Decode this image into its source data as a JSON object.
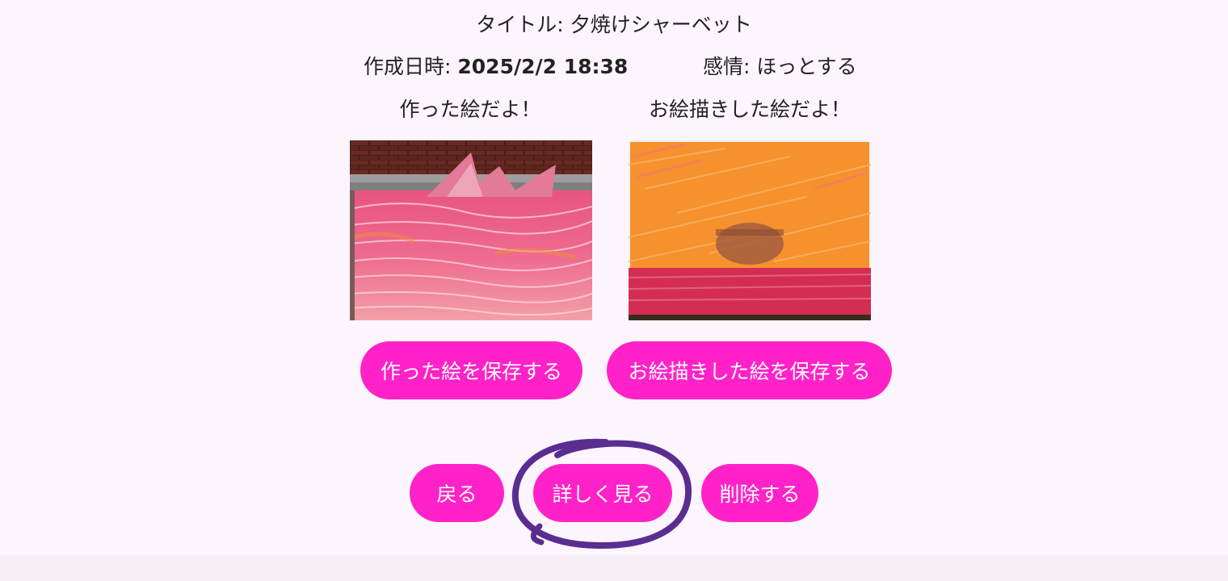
{
  "artwork": {
    "title_label": "タイトル:",
    "title_value": "夕焼けシャーベット",
    "created_label": "作成日時:",
    "created_value": "2025/2/2 18:38",
    "emotion_label": "感情:",
    "emotion_value": "ほっとする"
  },
  "images": {
    "made_caption": "作った絵だよ！",
    "drawn_caption": "お絵描きした絵だよ！"
  },
  "buttons": {
    "save_made": "作った絵を保存する",
    "save_drawn": "お絵描きした絵を保存する",
    "back": "戻る",
    "detail": "詳しく見る",
    "delete": "削除する"
  },
  "colors": {
    "accent": "#ff22c8",
    "background": "#fdf5fd",
    "annotation": "#5a2d91"
  }
}
